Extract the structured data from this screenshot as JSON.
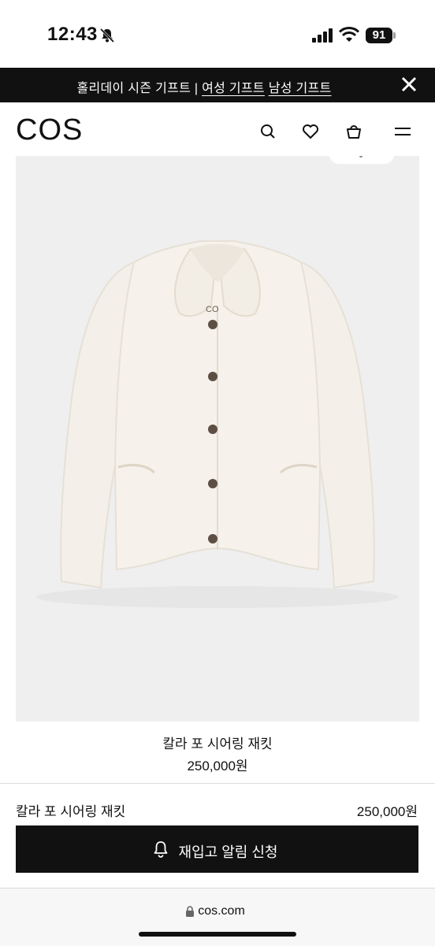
{
  "status_bar": {
    "time": "12:43",
    "battery": "91"
  },
  "promo": {
    "prefix": "홀리데이 시즌 기프트 | ",
    "link_women": "여성 기프트",
    "link_men": "남성 기프트"
  },
  "header": {
    "logo": "COS",
    "icons": [
      "search-icon",
      "heart-icon",
      "bag-icon",
      "menu-icon"
    ]
  },
  "product": {
    "name": "칼라 포 시어링 재킷",
    "price": "250,000원",
    "image_label": "CO"
  },
  "sticky_bar": {
    "name": "칼라 포 시어링 재킷",
    "price": "250,000원",
    "notify_label": "재입고 알림 신청"
  },
  "browser": {
    "url": "cos.com"
  },
  "colors": {
    "banner": "#111111",
    "image_bg": "#efefef",
    "jacket": "#f5f1ea",
    "button": "#111111"
  }
}
